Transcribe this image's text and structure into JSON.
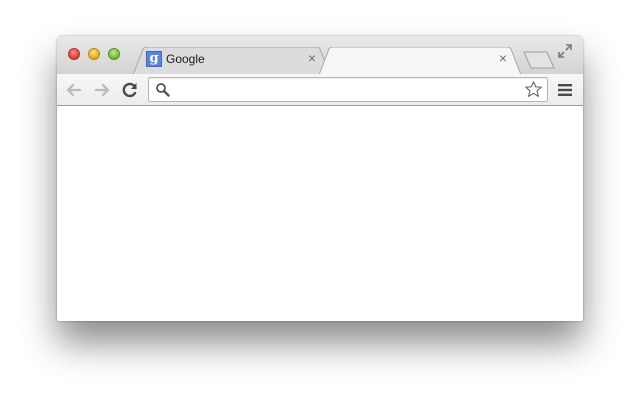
{
  "window": {
    "controls": [
      "close",
      "minimize",
      "zoom"
    ]
  },
  "tabs": [
    {
      "title": "Google",
      "favicon_letter": "g",
      "icon": "google-favicon-icon",
      "close_symbol": "×",
      "active": false
    },
    {
      "title": "",
      "icon": "",
      "close_symbol": "×",
      "active": true
    }
  ],
  "toolbar": {
    "back_icon": "arrow-left-icon",
    "forward_icon": "arrow-right-icon",
    "reload_icon": "reload-icon",
    "menu_icon": "hamburger-menu-icon"
  },
  "omnibox": {
    "value": "",
    "placeholder": "",
    "search_icon": "magnifier-icon",
    "bookmark_icon": "star-outline-icon"
  },
  "colors": {
    "tabstrip": "#d9d9d9",
    "toolbar": "#f2f2f2",
    "content": "#ffffff",
    "close_light": "#e0443e",
    "minimize_light": "#e8b126",
    "zoom_light": "#7fbd3c",
    "favicon": "#5b86e0"
  }
}
